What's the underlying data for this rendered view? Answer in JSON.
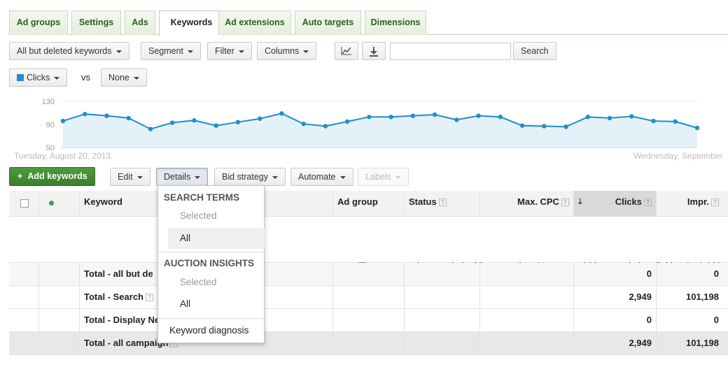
{
  "tabs": [
    "Ad groups",
    "Settings",
    "Ads",
    "Keywords",
    "Ad extensions",
    "Auto targets",
    "Dimensions"
  ],
  "toolbar": {
    "filter_select": "All but deleted keywords",
    "segment": "Segment",
    "filter": "Filter",
    "columns": "Columns",
    "search": "Search",
    "search_placeholder": ""
  },
  "metric": {
    "primary": "Clicks",
    "vs": "vs",
    "secondary": "None",
    "primary_color": "#1f8fc7"
  },
  "chart_data": {
    "type": "area",
    "ylim": [
      50,
      130
    ],
    "yticks": [
      "130",
      "90",
      "50"
    ],
    "date_start": "Tuesday, August 20, 2013",
    "date_end": "Wednesday, September",
    "values": [
      96,
      108,
      105,
      101,
      82,
      93,
      97,
      88,
      94,
      100,
      109,
      91,
      87,
      95,
      103,
      103,
      105,
      107,
      98,
      105,
      103,
      88,
      87,
      86,
      103,
      101,
      104,
      96,
      95,
      84
    ]
  },
  "actions": {
    "add_keywords": "Add keywords",
    "edit": "Edit",
    "details": "Details",
    "bid_strategy": "Bid strategy",
    "automate": "Automate",
    "labels": "Labels"
  },
  "table": {
    "headers": {
      "keyword": "Keyword",
      "ad_group": "Ad group",
      "status": "Status",
      "max_cpc": "Max. CPC",
      "clicks": "Clicks",
      "impr": "Impr."
    },
    "empty_message": "There are no keywords in this campaign. You can add keywords by clicking \"+ Add key",
    "totals": [
      {
        "label": "Total - all but de",
        "clicks": "0",
        "impr": "0"
      },
      {
        "label": "Total - Search",
        "clicks": "2,949",
        "impr": "101,198"
      },
      {
        "label": "Total - Display Ne",
        "clicks": "0",
        "impr": "0"
      },
      {
        "label": "Total - all campaign",
        "clicks": "2,949",
        "impr": "101,198"
      }
    ]
  },
  "details_menu": {
    "search_terms_heading": "SEARCH TERMS",
    "search_terms_selected": "Selected",
    "search_terms_all": "All",
    "auction_heading": "AUCTION INSIGHTS",
    "auction_selected": "Selected",
    "auction_all": "All",
    "diagnosis": "Keyword diagnosis"
  }
}
